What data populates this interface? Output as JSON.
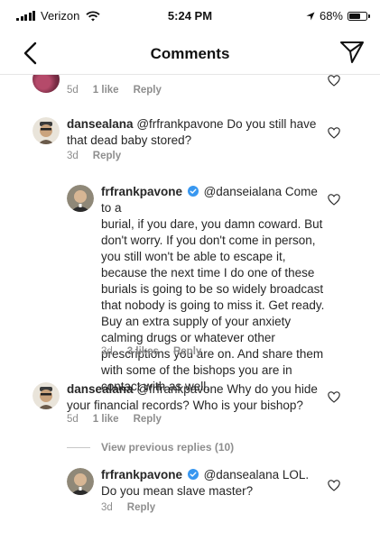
{
  "status_bar": {
    "carrier": "Verizon",
    "time": "5:24 PM",
    "battery_text": "68%",
    "battery_level": 0.68
  },
  "header": {
    "title": "Comments",
    "back_icon": "chevron-left-icon",
    "send_icon": "paper-plane-icon"
  },
  "comments": [
    {
      "time": "5d",
      "likes": "1 like",
      "reply": "Reply"
    },
    {
      "username": "dansealana",
      "text": "@frfrankpavone Do you still have that dead baby stored?",
      "time": "3d",
      "reply": "Reply"
    },
    {
      "username": "frfrankpavone",
      "verified": true,
      "text": "@danseialana Come to a burial, if you dare, you damn coward. But don't worry. If you don't come in person, you still won't be able to escape it, because the next time I do one of these burials is going to be so widely broadcast that nobody is going to miss it. Get ready. Buy an extra supply of your anxiety calming drugs or whatever other prescriptions you are on. And share them with some of the bishops you are in contact with as well.",
      "text_lines": [
        "@danseialana Come to a",
        "burial, if you dare, you damn coward. But",
        "don't worry. If you don't come in person,",
        "you still won't be able to escape it,",
        "because the next time I do one of these",
        "burials is going to be so widely broadcast",
        "that nobody is going to miss it. Get ready.",
        "Buy an extra supply of your anxiety",
        "calming drugs or whatever other",
        "prescriptions you are on. And share them",
        "with some of the bishops you are in",
        "contact with as well."
      ],
      "time": "3d",
      "likes": "3 likes",
      "reply": "Reply"
    },
    {
      "username": "dansealana",
      "text": "@frfrankpavone Why do you hide your financial records? Who is your bishop?",
      "time": "5d",
      "likes": "1 like",
      "reply": "Reply"
    },
    {
      "username": "frfrankpavone",
      "verified": true,
      "text": "@dansealana LOL. Do you mean slave master?",
      "time": "3d",
      "reply": "Reply"
    }
  ],
  "view_previous": "View previous replies (10)"
}
